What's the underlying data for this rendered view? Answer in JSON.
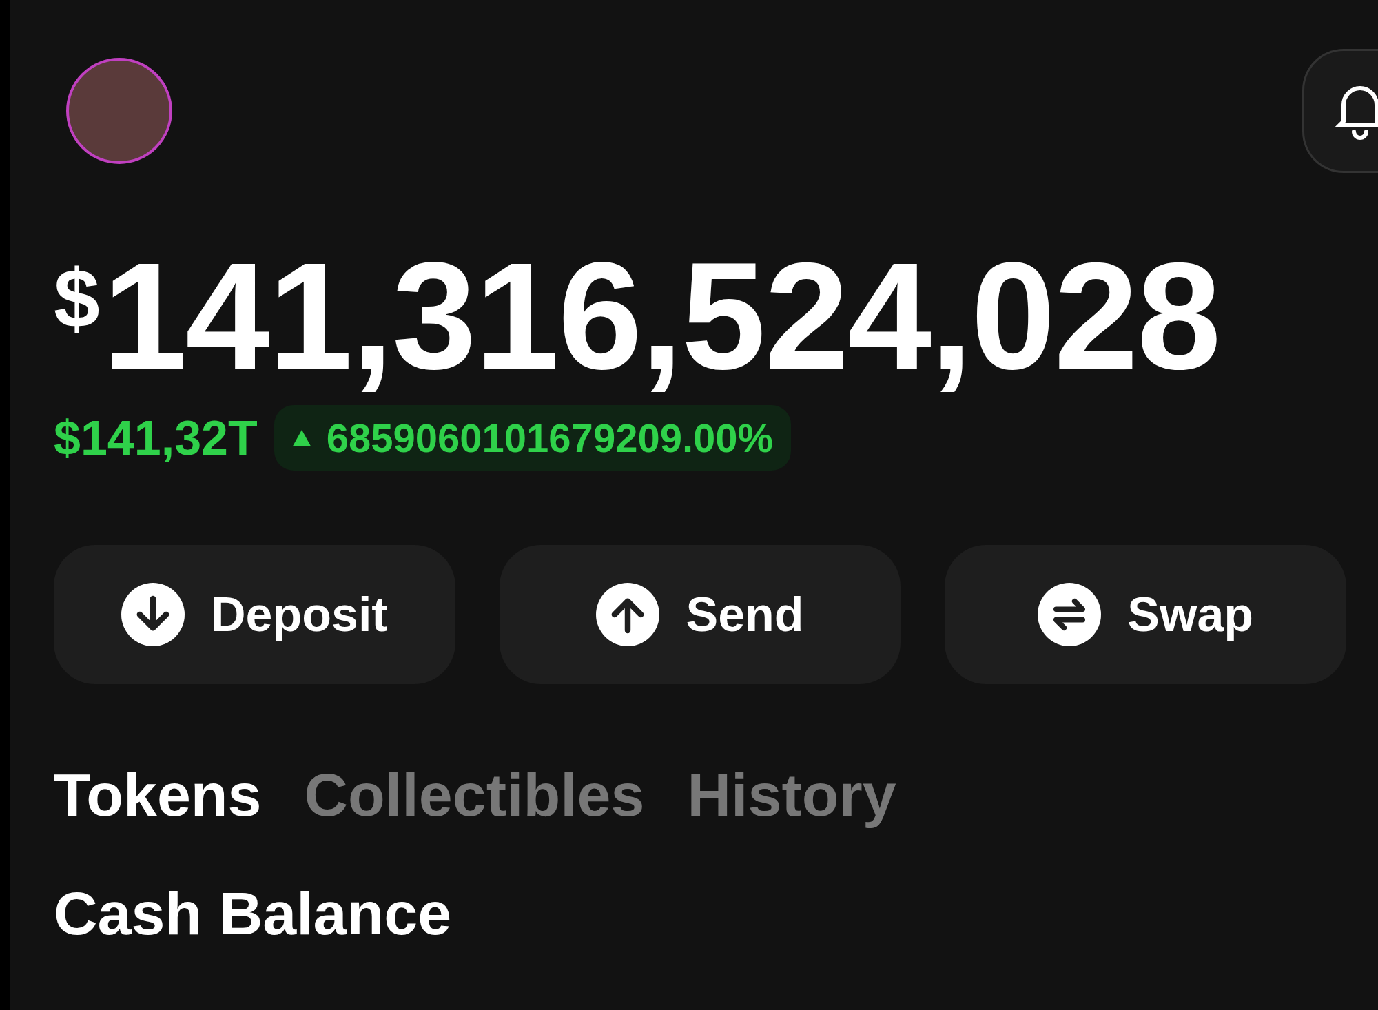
{
  "balance": {
    "currency": "$",
    "amount": "141,316,524,028"
  },
  "change": {
    "value": "$141,32T",
    "percent": "6859060101679209.00%"
  },
  "actions": [
    {
      "label": "Deposit",
      "kind": "deposit"
    },
    {
      "label": "Send",
      "kind": "send"
    },
    {
      "label": "Swap",
      "kind": "swap"
    }
  ],
  "tabs": [
    {
      "label": "Tokens",
      "selected": true
    },
    {
      "label": "Collectibles",
      "selected": false
    },
    {
      "label": "History",
      "selected": false
    }
  ],
  "section": {
    "title": "Cash Balance"
  }
}
